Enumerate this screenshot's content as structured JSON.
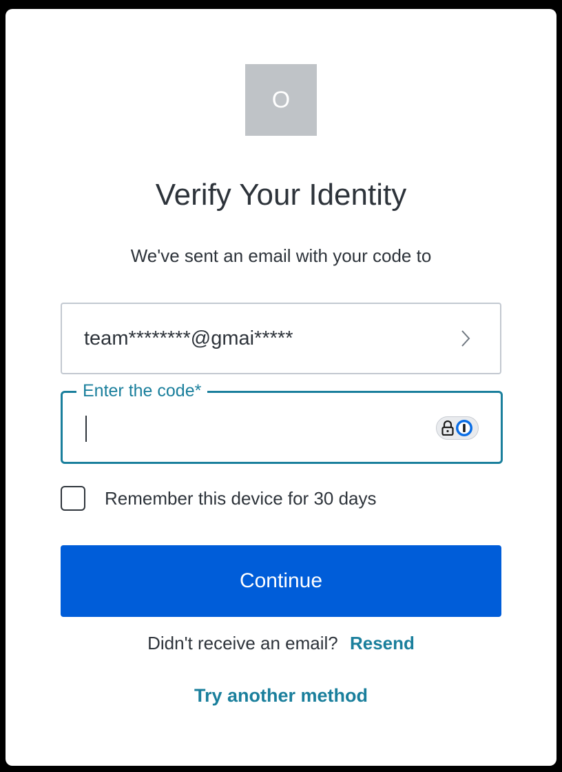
{
  "logo": {
    "letter": "O",
    "bg_color": "#bfc3c7"
  },
  "heading": "Verify Your Identity",
  "subtitle": "We've sent an email with your code to",
  "email_selector": {
    "value": "team********@gmai*****",
    "icon": "chevron-right-icon"
  },
  "code_field": {
    "label": "Enter the code*",
    "value": "",
    "accent_color": "#1a7f9c",
    "extension_icon": "password-manager-icon"
  },
  "remember_device": {
    "label": "Remember this device for 30 days",
    "checked": false
  },
  "continue_button": {
    "label": "Continue",
    "color": "#005dd9"
  },
  "resend": {
    "prompt": "Didn't receive an email?",
    "link": "Resend"
  },
  "another_method": "Try another method"
}
